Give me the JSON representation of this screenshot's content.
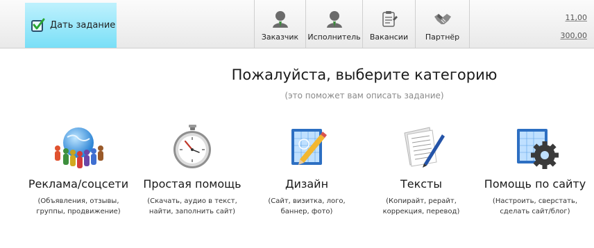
{
  "topbar": {
    "task_button": {
      "label": "Дать задание",
      "icon": "checkbox-check-icon",
      "color": "#8fe4f8"
    },
    "nav": [
      {
        "id": "customer",
        "label": "Заказчик",
        "icon": "user-icon"
      },
      {
        "id": "executor",
        "label": "Исполнитель",
        "icon": "user-icon"
      },
      {
        "id": "vacancies",
        "label": "Вакансии",
        "icon": "clipboard-icon"
      },
      {
        "id": "partner",
        "label": "Партнёр",
        "icon": "handshake-icon"
      }
    ],
    "stats": [
      "11,00",
      "300,00"
    ]
  },
  "main": {
    "title": "Пожалуйста, выберите категорию",
    "subtitle": "(это поможет вам описать задание)",
    "categories": [
      {
        "title": "Реклама/соцсети",
        "desc_line1": "(Объявления, отзывы,",
        "desc_line2": "группы, продвижение)",
        "icon": "people-globe-icon"
      },
      {
        "title": "Простая помощь",
        "desc_line1": "(Скачать, аудио в текст,",
        "desc_line2": "найти, заполнить сайт)",
        "icon": "stopwatch-icon"
      },
      {
        "title": "Дизайн",
        "desc_line1": "(Сайт, визитка, лого,",
        "desc_line2": "баннер, фото)",
        "icon": "design-pencil-icon"
      },
      {
        "title": "Тексты",
        "desc_line1": "(Копирайт, рерайт,",
        "desc_line2": "коррекция, перевод)",
        "icon": "document-pen-icon"
      },
      {
        "title": "Помощь по сайту",
        "desc_line1": "(Настроить, сверстать,",
        "desc_line2": "сделать сайт/блог)",
        "icon": "gear-window-icon"
      }
    ]
  }
}
